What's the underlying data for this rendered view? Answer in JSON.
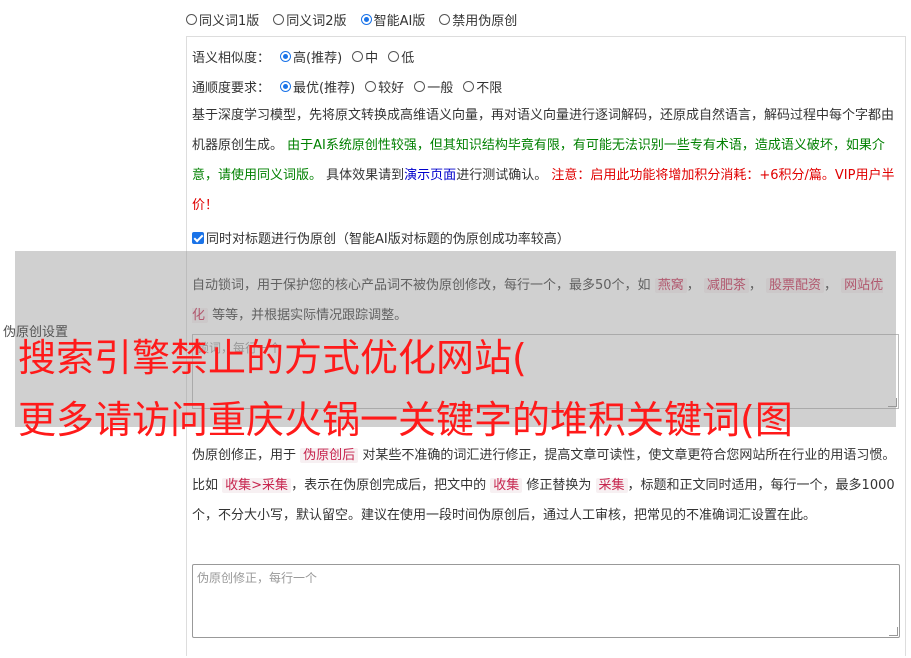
{
  "modes": {
    "options": [
      "同义词1版",
      "同义词2版",
      "智能AI版",
      "禁用伪原创"
    ],
    "selected": 2
  },
  "similarity": {
    "label": "语义相似度：",
    "options": [
      "高(推荐)",
      "中",
      "低"
    ],
    "selected": 0
  },
  "fluency": {
    "label": "通顺度要求：",
    "options": [
      "最优(推荐)",
      "较好",
      "一般",
      "不限"
    ],
    "selected": 0
  },
  "description": {
    "p1": "基于深度学习模型，先将原文转换成高维语义向量，再对语义向量进行逐词解码，还原成自然语言，解码过程中每个字都由机器原创生成。",
    "green": "由于AI系统原创性较强，但其知识结构毕竟有限，有可能无法识别一些专有术语，造成语义破坏，如果介意，请使用同义词版。",
    "p2": "具体效果请到",
    "link": "演示页面",
    "p3": "进行测试确认。",
    "red": "注意：启用此功能将增加积分消耗：+6积分/篇。VIP用户半价！"
  },
  "title_check": {
    "label": "同时对标题进行伪原创（智能AI版对标题的伪原创成功率较高）",
    "checked": true
  },
  "lock_words": {
    "p1": "自动锁词，用于保护您的核心产品词不被伪原创修改，每行一个，最多50个，如",
    "examples": [
      "燕窝",
      "减肥茶",
      "股票配资",
      "网站优化"
    ],
    "p2": "等等，并根据实际情况跟踪调整。",
    "placeholder": "锁词，每行一个"
  },
  "side_label": "伪原创设置",
  "headline": {
    "line1": "搜索引擎禁止的方式优化网站(",
    "line2": "更多请访问重庆火锅一关键字的堆积关键词(图"
  },
  "correction": {
    "p1": "伪原创修正，用于",
    "tag1": "伪原创后",
    "p2": "对某些不准确的词汇进行修正，提高文章可读性，使文章更符合您网站所在行业的用语习惯。比如",
    "tag2": "收集>采集",
    "p3": "，表示在伪原创完成后，把文中的",
    "tag3": "收集",
    "p4": "修正替换为",
    "tag4": "采集",
    "p5": "，标题和正文同时适用，每行一个，最多1000个，不分大小写，默认留空。建议在使用一段时间伪原创后，通过人工审核，把常见的不准确词汇设置在此。",
    "placeholder": "伪原创修正，每行一个"
  }
}
